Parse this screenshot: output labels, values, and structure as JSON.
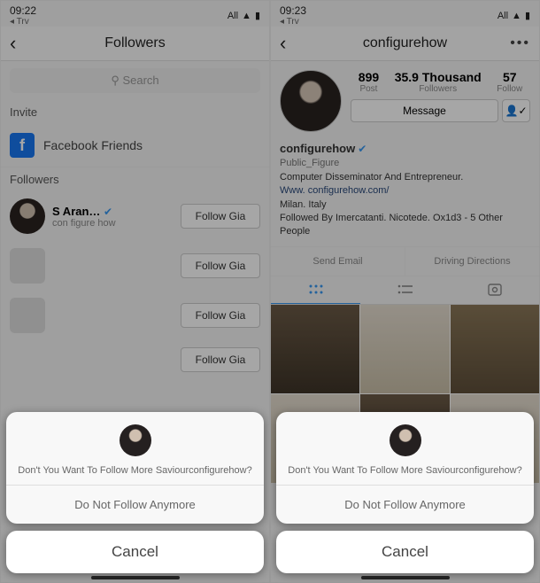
{
  "left": {
    "status": {
      "time": "09:22",
      "carrier": "Trv",
      "net": "All"
    },
    "header": {
      "title": "Followers"
    },
    "search": {
      "placeholder": "Search"
    },
    "invite_label": "Invite",
    "fb_label": "Facebook Friends",
    "followers_label": "Followers",
    "rows": [
      {
        "name": "S Aran…",
        "sub": "con figure how",
        "btn": "Follow Gia"
      },
      {
        "name": "",
        "sub": "",
        "btn": "Follow Gia"
      },
      {
        "name": "",
        "sub": "",
        "btn": "Follow Gia"
      },
      {
        "name": "",
        "sub": "",
        "btn": "Follow Gia"
      }
    ]
  },
  "right": {
    "status": {
      "time": "09:23",
      "carrier": "Trv",
      "net": "All"
    },
    "header": {
      "title": "configurehow"
    },
    "stats": {
      "posts": {
        "val": "899",
        "lbl": "Post"
      },
      "followers": {
        "val": "35.9 Thousand",
        "lbl": "Followers"
      },
      "following": {
        "val": "57",
        "lbl": "Follow"
      }
    },
    "msg_btn": "Message",
    "bio": {
      "handle": "configurehow",
      "category": "Public_Figure",
      "desc": "Computer Disseminator And Entrepreneur.",
      "link": "Www. configurehow.com/",
      "location": "Milan. Italy",
      "followed": "Followed By Imercatanti. Nicotede. Ox1d3 - 5 Other People"
    },
    "actions": {
      "email": "Send Email",
      "directions": "Driving Directions"
    }
  },
  "sheet": {
    "msg": "Don't You Want To Follow More Saviourconfigurehow?",
    "unfollow": "Do Not Follow Anymore",
    "cancel": "Cancel"
  }
}
